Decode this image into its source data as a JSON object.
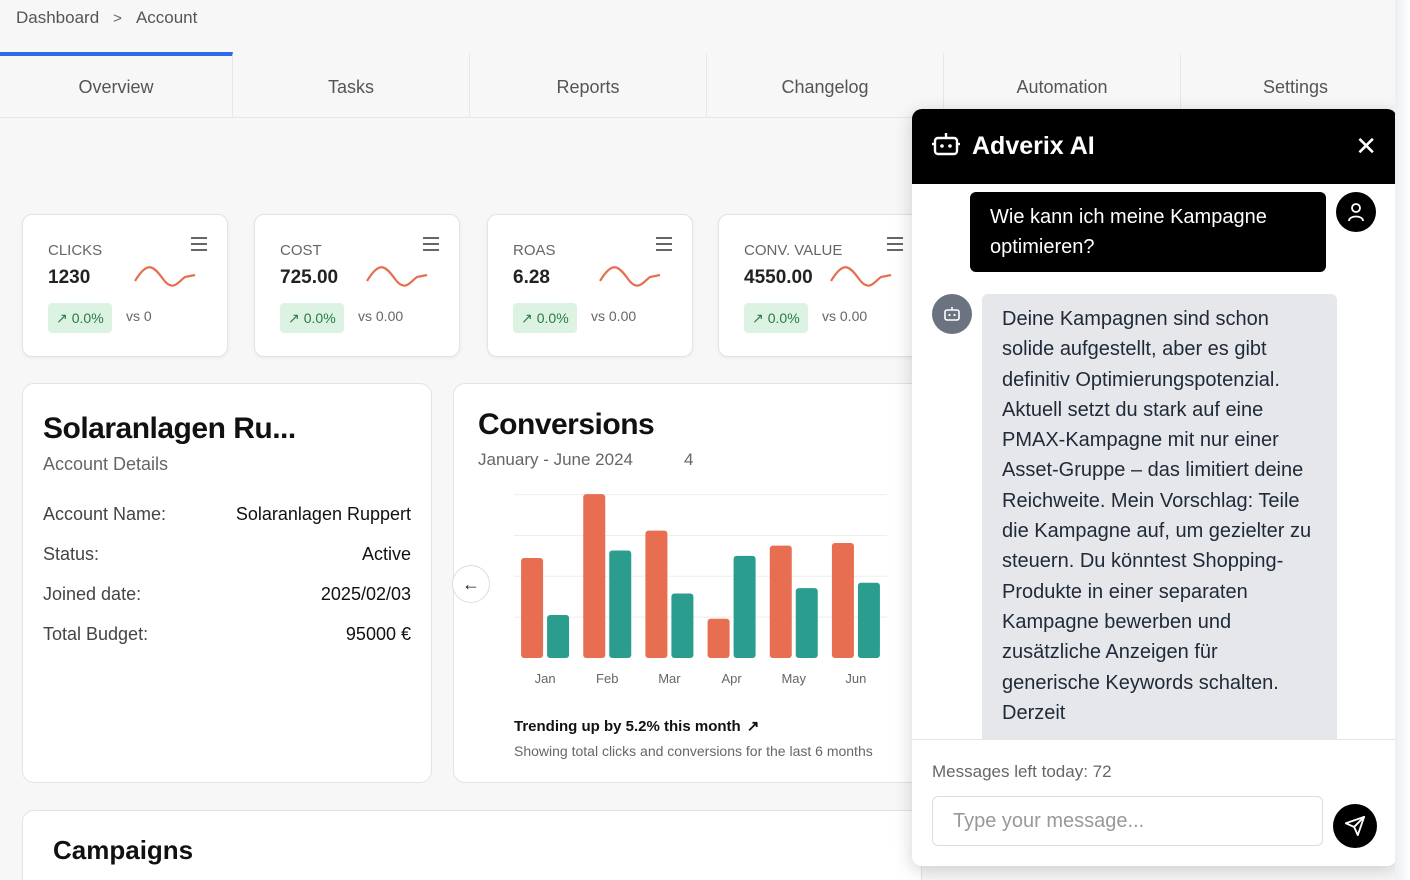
{
  "breadcrumb": {
    "items": [
      "Dashboard",
      "Account"
    ],
    "separator": ">"
  },
  "tabs": [
    {
      "label": "Overview",
      "active": true
    },
    {
      "label": "Tasks"
    },
    {
      "label": "Reports"
    },
    {
      "label": "Changelog"
    },
    {
      "label": "Automation"
    },
    {
      "label": "Settings"
    }
  ],
  "kpis": [
    {
      "label": "CLICKS",
      "value": "1230",
      "delta": "0.0%",
      "vs": "vs 0"
    },
    {
      "label": "COST",
      "value": "725.00",
      "delta": "0.0%",
      "vs": "vs 0.00"
    },
    {
      "label": "ROAS",
      "value": "6.28",
      "delta": "0.0%",
      "vs": "vs 0.00"
    },
    {
      "label": "CONV. VALUE",
      "value": "4550.00",
      "delta": "0.0%",
      "vs": "vs 0.00"
    }
  ],
  "account": {
    "title": "Solaranlagen Ru...",
    "subtitle": "Account Details",
    "rows": [
      {
        "key": "Account Name:",
        "value": "Solaranlagen Ruppert"
      },
      {
        "key": "Status:",
        "value": "Active"
      },
      {
        "key": "Joined date:",
        "value": "2025/02/03"
      },
      {
        "key": "Total Budget:",
        "value": "95000 €"
      }
    ]
  },
  "conversions": {
    "title": "Conversions",
    "subtitle": "January - June 2024",
    "ghost_text": "4",
    "trend_text": "Trending up by 5.2% this month",
    "footnote": "Showing total clicks and conversions for the last 6 months"
  },
  "chart_data": {
    "type": "bar",
    "categories": [
      "Jan",
      "Feb",
      "Mar",
      "Apr",
      "May",
      "Jun"
    ],
    "series": [
      {
        "values": [
          186,
          305,
          237,
          73,
          209,
          214
        ],
        "color": "#e76e50"
      },
      {
        "values": [
          80,
          200,
          120,
          190,
          130,
          140
        ],
        "color": "#2a9d8f"
      }
    ],
    "ylim": [
      0,
      320
    ],
    "grid": true
  },
  "campaigns": {
    "title": "Campaigns"
  },
  "chat": {
    "title": "Adverix AI",
    "user_message": "Wie kann ich meine Kampagne optimieren?",
    "bot_message": "Deine Kampagnen sind schon solide aufgestellt, aber es gibt definitiv Optimierungspotenzial. Aktuell setzt du stark auf eine PMAX-Kampagne mit nur einer Asset-Gruppe – das limitiert deine Reichweite. Mein Vorschlag: Teile die Kampagne auf, um gezielter zu steuern. Du könntest Shopping-Produkte in einer separaten Kampagne bewerben und zusätzliche Anzeigen für generische Keywords schalten. Derzeit",
    "messages_left": "Messages left today: 72",
    "input_placeholder": "Type your message..."
  },
  "icons": {
    "menu": "hamburger-icon",
    "trend": "trending-up-icon",
    "bot": "robot-icon",
    "user": "user-icon",
    "close": "close-icon",
    "send": "send-icon",
    "arrow": "arrow-left-icon"
  }
}
